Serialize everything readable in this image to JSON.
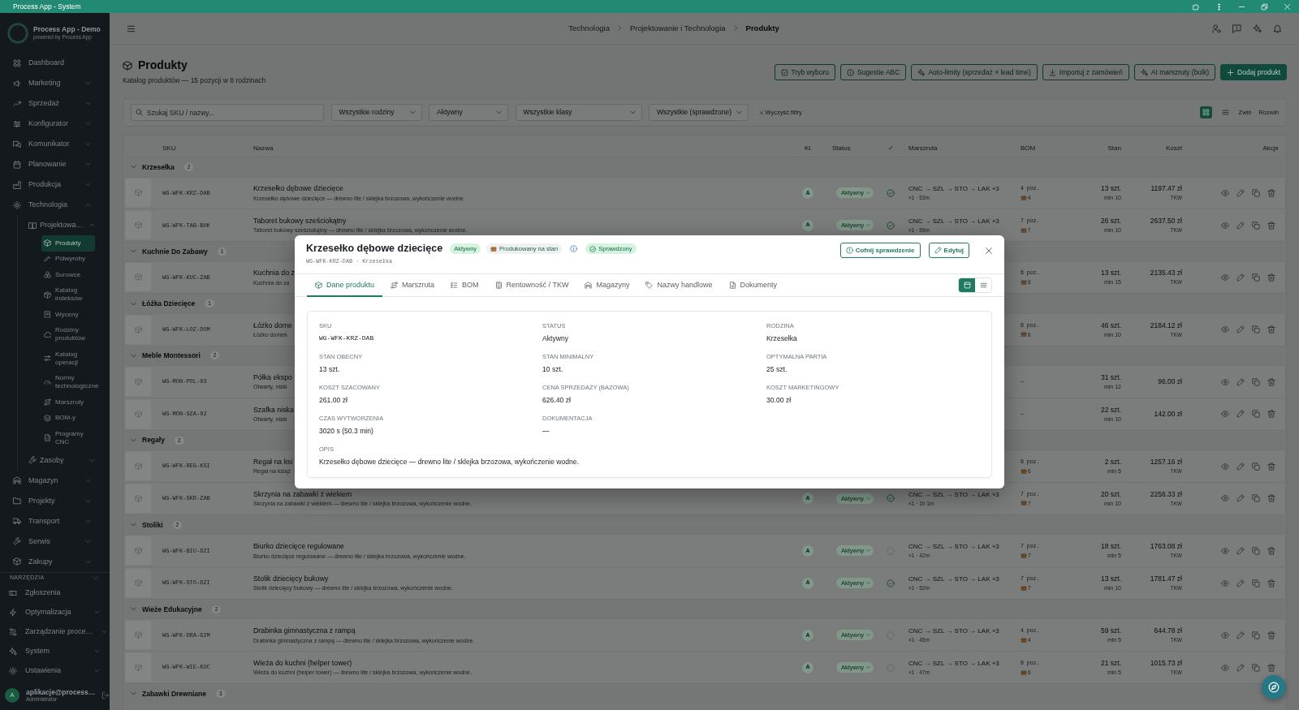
{
  "window": {
    "title": "Process App - System"
  },
  "sidebar": {
    "app_name": "Process App - Demo",
    "app_tagline": "powered by Process App",
    "items": [
      {
        "label": "Dashboard",
        "kind": "link",
        "selected": false
      },
      {
        "label": "Marketing",
        "kind": "group",
        "expanded": false,
        "selected": false
      },
      {
        "label": "Sprzedaż",
        "kind": "group",
        "expanded": false,
        "selected": false
      },
      {
        "label": "Konfigurator",
        "kind": "group",
        "expanded": false,
        "selected": false
      },
      {
        "label": "Komunikator",
        "kind": "group",
        "expanded": false,
        "selected": false
      },
      {
        "label": "Planowanie",
        "kind": "group",
        "expanded": false,
        "selected": false
      },
      {
        "label": "Produkcja",
        "kind": "group",
        "expanded": false,
        "selected": false
      },
      {
        "label": "Technologia",
        "kind": "group",
        "expanded": true,
        "selected": false,
        "children": [
          {
            "label": "Projektowa…",
            "kind": "group",
            "expanded": true,
            "selected": false,
            "children": [
              {
                "label": "Produkty",
                "kind": "link",
                "selected": true
              },
              {
                "label": "Półwyroby",
                "kind": "link",
                "selected": false
              },
              {
                "label": "Surowce",
                "kind": "link",
                "selected": false
              },
              {
                "label": "Katalog indeksów",
                "kind": "link",
                "selected": false
              },
              {
                "label": "Wyceny",
                "kind": "link",
                "selected": false
              },
              {
                "label": "Rodziny produktów",
                "kind": "link",
                "selected": false
              },
              {
                "label": "Katalog operacji",
                "kind": "link",
                "selected": false
              },
              {
                "label": "Normy technologiczne",
                "kind": "link",
                "selected": false
              },
              {
                "label": "Marszruty",
                "kind": "link",
                "selected": false
              },
              {
                "label": "BOM-y",
                "kind": "link",
                "selected": false
              },
              {
                "label": "Programy CNC",
                "kind": "link",
                "selected": false
              }
            ]
          },
          {
            "label": "Zasoby",
            "kind": "group",
            "expanded": false,
            "selected": false
          }
        ]
      },
      {
        "label": "Magazyn",
        "kind": "group",
        "expanded": false,
        "selected": false
      },
      {
        "label": "Projekty",
        "kind": "group",
        "expanded": false,
        "selected": false
      },
      {
        "label": "Transport",
        "kind": "group",
        "expanded": false,
        "selected": false
      },
      {
        "label": "Serwis",
        "kind": "group",
        "expanded": false,
        "selected": false
      },
      {
        "label": "Zakupy",
        "kind": "group",
        "expanded": false,
        "selected": false
      }
    ],
    "tools": {
      "title": "NARZĘDZIA",
      "items": [
        {
          "label": "Zgłoszenia",
          "kind": "link",
          "selected": false
        },
        {
          "label": "Optymalizacja",
          "kind": "group",
          "expanded": false,
          "selected": false
        },
        {
          "label": "Zarządzanie proce…",
          "kind": "group",
          "expanded": false,
          "selected": false
        },
        {
          "label": "System",
          "kind": "group",
          "expanded": false,
          "selected": false
        },
        {
          "label": "Ustawienia",
          "kind": "group",
          "expanded": false,
          "selected": false
        }
      ]
    },
    "user": {
      "initial": "A",
      "name": "aplikacje@process…",
      "role": "Administrator"
    }
  },
  "topbar": {
    "breadcrumb": [
      {
        "label": "Technologia",
        "current": false
      },
      {
        "label": "Projektowanie i Technologia",
        "current": false
      },
      {
        "label": "Produkty",
        "current": true
      }
    ]
  },
  "page": {
    "title": "Produkty",
    "subtitle": "Katalog produktów — 15 pozycji w 8 rodzinach",
    "actions": [
      {
        "label": "Tryb wyboru",
        "kind": "select"
      },
      {
        "label": "Sugestie ABC",
        "kind": "abc"
      },
      {
        "label": "Auto-limity (sprzedaż × lead time)",
        "kind": "ai"
      },
      {
        "label": "Importuj z zamówień",
        "kind": "import"
      },
      {
        "label": "AI marszruty (bulk)",
        "kind": "ai"
      },
      {
        "label": "Dodaj produkt",
        "kind": "add"
      }
    ]
  },
  "filters": {
    "search": {
      "placeholder": "Szukaj SKU / nazwy..."
    },
    "dropdowns": [
      {
        "value": "Wszystkie rodziny"
      },
      {
        "value": "Aktywny"
      },
      {
        "value": "Wszystkie klasy"
      },
      {
        "value": "Wszystkie (sprawdzone)"
      }
    ],
    "clear": "Wyczyść filtry",
    "views": [
      {
        "kind": "grid",
        "selected": true
      },
      {
        "kind": "list",
        "selected": false
      }
    ],
    "collapse": "Zwiń",
    "expand": "Rozwiń"
  },
  "table": {
    "columns": [
      "SKU",
      "Nazwa",
      "Kl.",
      "Status",
      "✓",
      "Marszruta",
      "BOM",
      "Stan",
      "Koszt",
      "Akcje"
    ],
    "groups": [
      {
        "name": "Krzesełka",
        "count": "2",
        "expanded": true,
        "rows": [
          {
            "sku": "WG-WFK-KRZ-DAB",
            "name": "Krzesełko dębowe dziecięce",
            "description": "Krzesełko dębowe dziecięce — drewno lite / sklejka brzozowa, wykończenie wodne.",
            "class": "A",
            "status": "Aktywny",
            "checked": true,
            "route": "CNC → SZL → STO → LAK +3",
            "route_meta": "×1 · 53m",
            "bom": "4 poz.",
            "bom_count": "4",
            "stock": "13 szt.",
            "minimum": "min 10",
            "cost": "1197.47 zł",
            "cost_note": "TKW"
          },
          {
            "sku": "WG-WFK-TAB-BUK",
            "name": "Taboret bukowy sześciokątny",
            "description": "Taboret bukowy sześciokątny — drewno lite / sklejka brzozowa, wykończenie wodne.",
            "class": "A",
            "status": "Aktywny",
            "checked": true,
            "route": "CNC → SZL → STO → LAK +3",
            "route_meta": "×1 · 59m",
            "bom": "7 poz.",
            "bom_count": "7",
            "stock": "26 szt.",
            "minimum": "min 10",
            "cost": "2637.50 zł",
            "cost_note": "TKW"
          }
        ]
      },
      {
        "name": "Kuchnie Do Zabawy",
        "count": "1",
        "expanded": true,
        "rows": [
          {
            "sku": "WG-WFK-KUC-ZAB",
            "name": "Kuchnia do z",
            "description": "Kuchnia do za",
            "bom": "6 poz.",
            "bom_count": "6",
            "stock": "13 szt.",
            "minimum": "min 15",
            "cost": "2135.43 zł",
            "cost_note": "TKW"
          }
        ]
      },
      {
        "name": "Łóżka Dziecięce",
        "count": "1",
        "expanded": true,
        "rows": [
          {
            "sku": "WG-WFK-LOZ-DOM",
            "name": "Łóżko dome",
            "description": "Łóżko domek",
            "bom": "6 poz.",
            "bom_count": "6",
            "stock": "46 szt.",
            "minimum": "min 10",
            "cost": "2184.12 zł",
            "cost_note": "TKW"
          }
        ]
      },
      {
        "name": "Meble Montessori",
        "count": "2",
        "expanded": true,
        "rows": [
          {
            "sku": "WG-MON-POL-03",
            "name": "Półka ekspo",
            "description": "Otwarty, niski",
            "bom": "—",
            "stock": "31 szt.",
            "minimum": "min 12",
            "cost": "96.00 zł"
          },
          {
            "sku": "WG-MON-SZA-02",
            "name": "Szafka niska",
            "description": "Otwarty, niski",
            "bom": "—",
            "stock": "22 szt.",
            "minimum": "min 10",
            "cost": "142.00 zł"
          }
        ]
      },
      {
        "name": "Regały",
        "count": "2",
        "expanded": true,
        "rows": [
          {
            "sku": "WG-WFK-REG-KSI",
            "name": "Regał na ksi",
            "description": "Regał na książ",
            "bom": "6 poz.",
            "bom_count": "6",
            "stock": "2 szt.",
            "minimum": "min 5",
            "cost": "1257.16 zł",
            "cost_note": "TKW"
          },
          {
            "sku": "WG-WFK-SKR-ZAB",
            "name": "Skrzynia na zabawki z wiekiem",
            "description": "Skrzynia na zabawki z wiekiem — drewno lite / sklejka brzozowa, wykończenie wodne.",
            "class": "A",
            "status": "Aktywny",
            "checked": true,
            "route": "CNC → SZL → STO → LAK +3",
            "route_meta": "×1 · 1h 1m",
            "bom": "7 poz.",
            "bom_count": "7",
            "stock": "20 szt.",
            "minimum": "min 10",
            "cost": "2256.33 zł",
            "cost_note": "TKW"
          }
        ]
      },
      {
        "name": "Stoliki",
        "count": "2",
        "expanded": true,
        "rows": [
          {
            "sku": "WG-WFK-BIU-DZI",
            "name": "Biurko dziecięce regulowane",
            "description": "Biurko dziecięce regulowane — drewno lite / sklejka brzozowa, wykończenie wodne.",
            "class": "A",
            "status": "Aktywny",
            "checked": false,
            "route": "CNC → SZL → STO → LAK +3",
            "route_meta": "×1 · 42m",
            "bom": "7 poz.",
            "bom_count": "7",
            "stock": "18 szt.",
            "minimum": "min 5",
            "cost": "1763.08 zł",
            "cost_note": "TKW"
          },
          {
            "sku": "WG-WFK-STO-DZI",
            "name": "Stolik dziecięcy bukowy",
            "description": "Stolik dziecięcy bukowy — drewno lite / sklejka brzozowa, wykończenie wodne.",
            "class": "A",
            "status": "Aktywny",
            "checked": true,
            "route": "CNC → SZL → STO → LAK +3",
            "route_meta": "×1 · 52m",
            "bom": "7 poz.",
            "bom_count": "7",
            "stock": "13 szt.",
            "minimum": "min 10",
            "cost": "1781.47 zł",
            "cost_note": "TKW"
          }
        ]
      },
      {
        "name": "Wieże Edukacyjne",
        "count": "2",
        "expanded": true,
        "rows": [
          {
            "sku": "WG-WFK-DRA-GIM",
            "name": "Drabinka gimnastyczna z rampą",
            "description": "Drabinka gimnastyczna z rampą — drewno lite / sklejka brzozowa, wykończenie wodne.",
            "class": "A",
            "status": "Aktywny",
            "checked": false,
            "route": "CNC → SZL → STO → LAK +3",
            "route_meta": "×1 · 45m",
            "bom": "4 poz.",
            "bom_count": "4",
            "stock": "59 szt.",
            "minimum": "min 5",
            "cost": "644.78 zł",
            "cost_note": "TKW"
          },
          {
            "sku": "WG-WFK-WIE-KUC",
            "name": "Wieża do kuchni (helper tower)",
            "description": "Wieża do kuchni (helper tower) — drewno lite / sklejka brzozowa, wykończenie wodne.",
            "class": "A",
            "status": "Aktywny",
            "checked": false,
            "route": "CNC → SZL → STO → LAK +3",
            "route_meta": "×1 · 47m",
            "bom": "6 poz.",
            "bom_count": "6",
            "stock": "21 szt.",
            "minimum": "min 5",
            "cost": "1015.73 zł",
            "cost_note": "TKW"
          }
        ]
      },
      {
        "name": "Zabawki Drewniane",
        "count": "3",
        "expanded": true
      }
    ]
  },
  "modal": {
    "title": "Krzesełko dębowe dziecięce",
    "badges": [
      {
        "kind": "status",
        "label": "Aktywny"
      },
      {
        "kind": "stock",
        "label": "Produkowany na stan"
      },
      {
        "kind": "verified",
        "label": "Sprawdzony"
      }
    ],
    "subtitle": "WG-WFK-KRZ-DAB · Krzesełka",
    "actions": [
      {
        "kind": "undo",
        "label": "Cofnij sprawdzenie"
      },
      {
        "kind": "edit",
        "label": "Edytuj"
      }
    ],
    "tabs": [
      {
        "label": "Dane produktu",
        "selected": true
      },
      {
        "label": "Marszruta",
        "selected": false
      },
      {
        "label": "BOM",
        "selected": false
      },
      {
        "label": "Rentowność / TKW",
        "selected": false
      },
      {
        "label": "Magazyny",
        "selected": false
      },
      {
        "label": "Nazwy handlowe",
        "selected": false
      },
      {
        "label": "Dokumenty",
        "selected": false
      }
    ],
    "views": [
      {
        "kind": "card",
        "selected": true
      },
      {
        "kind": "list",
        "selected": false
      }
    ],
    "fields": [
      {
        "label": "SKU",
        "value": "WG-WFK-KRZ-DAB",
        "kind": "code"
      },
      {
        "label": "STATUS",
        "value": "Aktywny",
        "kind": "text"
      },
      {
        "label": "RODZINA",
        "value": "Krzesełka",
        "kind": "text"
      },
      {
        "label": "STAN OBECNY",
        "value": "13 szt.",
        "kind": "text"
      },
      {
        "label": "STAN MINIMALNY",
        "value": "10 szt.",
        "kind": "text"
      },
      {
        "label": "OPTYMALNA PARTIA",
        "value": "25 szt.",
        "kind": "text"
      },
      {
        "label": "KOSZT SZACOWANY",
        "value": "261.00 zł",
        "kind": "text"
      },
      {
        "label": "CENA SPRZEDAŻY (BAZOWA)",
        "value": "626.40 zł",
        "kind": "text"
      },
      {
        "label": "KOSZT MARKETINGOWY",
        "value": "30.00 zł",
        "kind": "text"
      },
      {
        "label": "CZAS WYTWORZENIA",
        "value": "3020 s (50.3 min)",
        "kind": "text"
      },
      {
        "label": "DOKUMENTACJA",
        "value": "—",
        "kind": "text"
      },
      {
        "label": "OPIS",
        "value": "Krzesełko dębowe dziecięce — drewno lite / sklejka brzozowa, wykończenie wodne.",
        "kind": "wide"
      }
    ]
  }
}
